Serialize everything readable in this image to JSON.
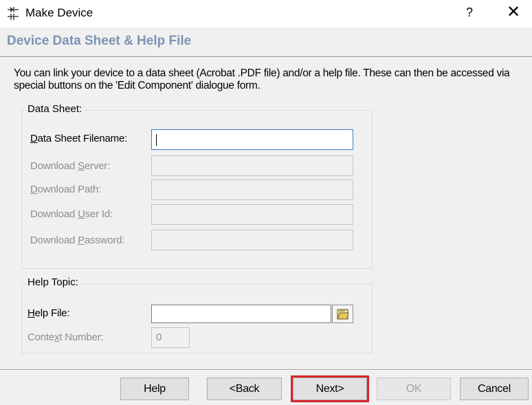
{
  "window": {
    "title": "Make Device",
    "help_button": "?",
    "close_button": "✕"
  },
  "header": {
    "heading": "Device Data Sheet & Help File"
  },
  "description": "You can link your device to a data sheet (Acrobat .PDF file) and/or a help file. These can then be accessed via special buttons on the 'Edit Component' dialogue form.",
  "data_sheet": {
    "group_label": "Data Sheet:",
    "fields": [
      {
        "label_pre": "",
        "label_key": "D",
        "label_post": "ata Sheet Filename:",
        "value": "",
        "enabled": true
      },
      {
        "label_pre": "Download ",
        "label_key": "S",
        "label_post": "erver:",
        "value": "",
        "enabled": false
      },
      {
        "label_pre": "",
        "label_key": "D",
        "label_post": "ownload Path:",
        "value": "",
        "enabled": false
      },
      {
        "label_pre": "Download ",
        "label_key": "U",
        "label_post": "ser Id:",
        "value": "",
        "enabled": false
      },
      {
        "label_pre": "Download ",
        "label_key": "P",
        "label_post": "assword:",
        "value": "",
        "enabled": false
      }
    ]
  },
  "help_topic": {
    "group_label": "Help Topic:",
    "help_file": {
      "label_pre": "",
      "label_key": "H",
      "label_post": "elp File:",
      "value": ""
    },
    "context_number": {
      "label_pre": "Conte",
      "label_key": "x",
      "label_post": "t Number:",
      "value": "0"
    }
  },
  "footer": {
    "buttons": {
      "help": "Help",
      "back": "<Back",
      "next": "Next>",
      "ok": "OK",
      "cancel": "Cancel"
    },
    "highlighted": "next",
    "highlight_color": "#d9232b"
  },
  "colors": {
    "heading": "#7b94b3",
    "active_border": "#3b79c7",
    "disabled_text": "#8d8d8d"
  },
  "icons": {
    "app": "make-device-icon",
    "browse": "folder-browse-icon"
  }
}
